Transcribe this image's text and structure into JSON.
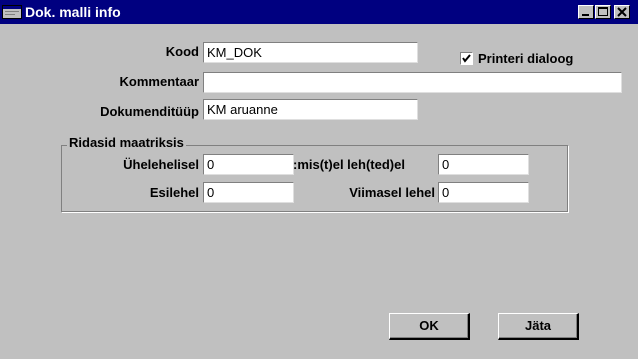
{
  "window": {
    "title": "Dok. malli info"
  },
  "title_buttons": {
    "minimize_icon": "minimize-icon",
    "maximize_icon": "maximize-icon",
    "close_icon": "close-icon"
  },
  "form": {
    "kood_label": "Kood",
    "kood_value": "KM_DOK",
    "printeri_dialoog_label": "Printeri dialoog",
    "printeri_dialoog_checked": true,
    "kommentaar_label": "Kommentaar",
    "kommentaar_value": "",
    "dokumenditüüp_label": "Dokumenditüüp",
    "dokumenditüüp_value": "KM aruanne"
  },
  "group": {
    "title": "Ridasid maatriksis",
    "uhelehelisel_label": "Ühelehelisel",
    "uhelehelisel_value": "0",
    "vahelehtedel_label": ":mis(t)el leh(ted)el",
    "vahelehtedel_value": "0",
    "esilehel_label": "Esilehel",
    "esilehel_value": "0",
    "viimasel_lehel_label": "Viimasel lehel",
    "viimasel_lehel_value": "0"
  },
  "buttons": {
    "ok_label": "OK",
    "jata_label": "Jäta"
  },
  "colors": {
    "titlebar": "#000080",
    "dialog_bg": "#c0c0c0"
  }
}
